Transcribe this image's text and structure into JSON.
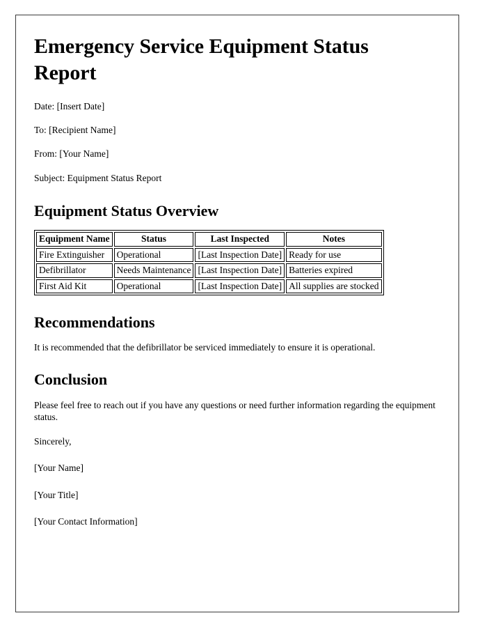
{
  "document": {
    "title": "Emergency Service Equipment Status Report",
    "meta": [
      {
        "label": "Date:",
        "value": "[Insert Date]",
        "text": "Date: [Insert Date]"
      },
      {
        "label": "To:",
        "value": "[Recipient Name]",
        "text": "To: [Recipient Name]"
      },
      {
        "label": "From:",
        "value": "[Your Name]",
        "text": "From: [Your Name]"
      },
      {
        "label": "Subject:",
        "value": "Equipment Status Report",
        "text": "Subject: Equipment Status Report"
      }
    ],
    "sections": {
      "overview": {
        "heading": "Equipment Status Overview",
        "table": {
          "columns": [
            "Equipment Name",
            "Status",
            "Last Inspected",
            "Notes"
          ],
          "rows": [
            [
              "Fire Extinguisher",
              "Operational",
              "[Last Inspection Date]",
              "Ready for use"
            ],
            [
              "Defibrillator",
              "Needs Maintenance",
              "[Last Inspection Date]",
              "Batteries expired"
            ],
            [
              "First Aid Kit",
              "Operational",
              "[Last Inspection Date]",
              "All supplies are stocked"
            ]
          ]
        }
      },
      "recommendations": {
        "heading": "Recommendations",
        "body": "It is recommended that the defibrillator be serviced immediately to ensure it is operational."
      },
      "conclusion": {
        "heading": "Conclusion",
        "body": "Please feel free to reach out if you have any questions or need further information regarding the equipment status."
      }
    },
    "signature": {
      "closing": "Sincerely,",
      "name": "[Your Name]",
      "title": "[Your Title]",
      "contact": "[Your Contact Information]"
    }
  },
  "colors": {
    "page_background": "#ffffff",
    "frame_border": "#3a3a3a",
    "text": "#000000",
    "table_border": "#000000"
  }
}
